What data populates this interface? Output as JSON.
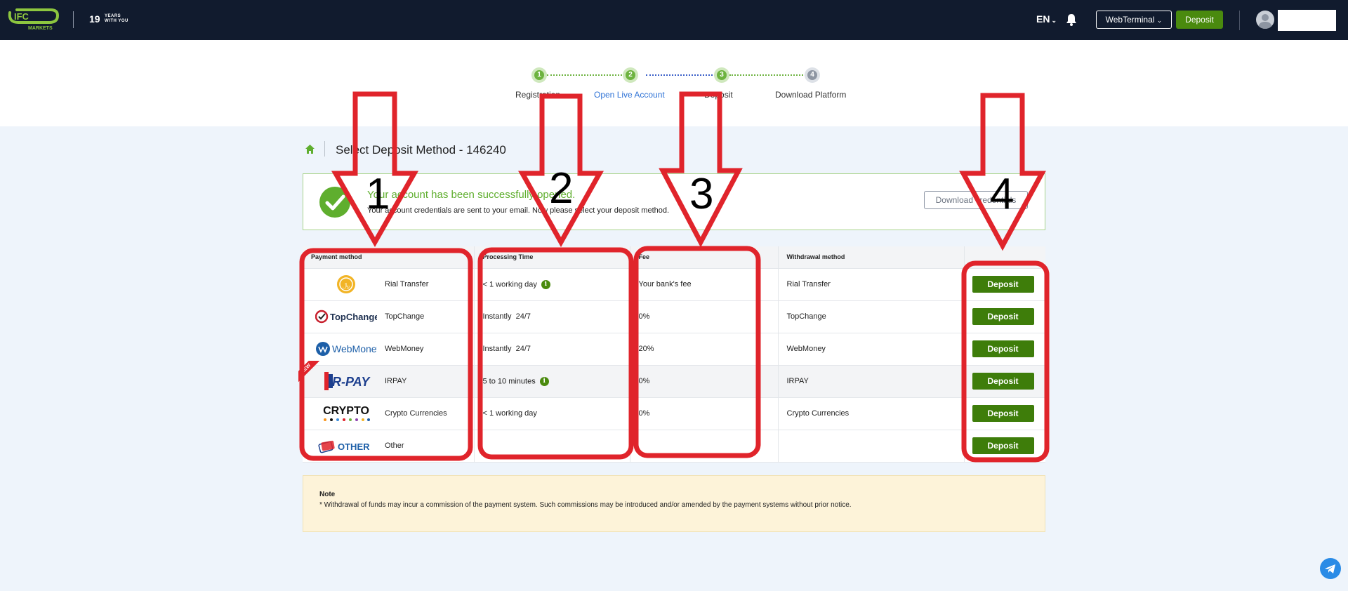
{
  "header": {
    "brand_top": "IFC",
    "brand_sub": "MARKETS",
    "years_number": "19",
    "years_text": "YEARS\nWITH YOU",
    "language": "EN",
    "webterminal_label": "WebTerminal",
    "deposit_label": "Deposit"
  },
  "stepper": {
    "steps": [
      {
        "number": "1",
        "label": "Registration",
        "state": "done"
      },
      {
        "number": "2",
        "label": "Open Live Account",
        "state": "done"
      },
      {
        "number": "3",
        "label": "Deposit",
        "state": "done"
      },
      {
        "number": "4",
        "label": "Download Platform",
        "state": "todo"
      }
    ]
  },
  "page": {
    "title": "Select Deposit Method - 146240"
  },
  "success": {
    "title": "Your account has been successfully opened.",
    "subtitle": "Your account credentials are sent to your email. Now please select your deposit method.",
    "download_button": "Download credentials"
  },
  "table": {
    "headers": [
      "Payment method",
      "Processing Time",
      "Fee",
      "Withdrawal method",
      ""
    ],
    "rows": [
      {
        "logo": "RIAL",
        "method": "Rial Transfer",
        "time": "< 1 working day",
        "info": true,
        "fee": "Your bank's fee",
        "withdrawal": "Rial Transfer",
        "button": "Deposit"
      },
      {
        "logo": "TopChange",
        "method": "TopChange",
        "time": "Instantly  24/7",
        "info": false,
        "fee": "0%",
        "withdrawal": "TopChange",
        "button": "Deposit"
      },
      {
        "logo": "WebMoney",
        "method": "WebMoney",
        "time": "Instantly  24/7",
        "info": false,
        "fee": "20%",
        "withdrawal": "WebMoney",
        "button": "Deposit"
      },
      {
        "logo": "IR-PAY",
        "method": "IRPAY",
        "time": "5 to 10 minutes",
        "info": true,
        "fee": "0%",
        "withdrawal": "IRPAY",
        "button": "Deposit",
        "badge": "NEW"
      },
      {
        "logo": "CRYPTO",
        "method": "Crypto Currencies",
        "time": "< 1 working day",
        "info": false,
        "fee": "0%",
        "withdrawal": "Crypto Currencies",
        "button": "Deposit"
      },
      {
        "logo": "OTHER",
        "method": "Other",
        "time": "",
        "info": false,
        "fee": "",
        "withdrawal": "",
        "button": "Deposit"
      }
    ]
  },
  "note": {
    "title": "Note",
    "text": "* Withdrawal of funds may incur a commission of the payment system. Such commissions may be introduced and/or amended by the payment systems without prior notice."
  },
  "annotations": {
    "labels": [
      "1",
      "2",
      "3",
      "4"
    ],
    "color": "#e0242b"
  },
  "colors": {
    "topbar": "#111b2e",
    "accent_green": "#4a8a0e",
    "success_green": "#5fae2e",
    "link_blue": "#2f73d6"
  }
}
